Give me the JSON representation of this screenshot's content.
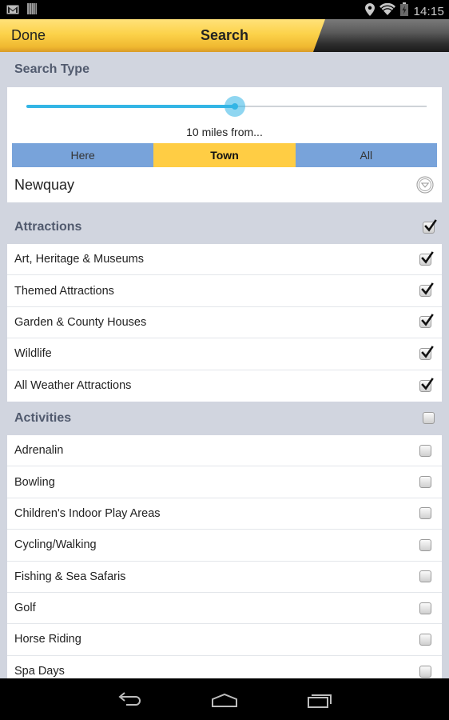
{
  "status_bar": {
    "time": "14:15",
    "left_icons": [
      "gmail-icon",
      "barcode-icon"
    ],
    "right_icons": [
      "location-icon",
      "wifi-icon",
      "battery-charging-icon"
    ]
  },
  "action_bar": {
    "done_label": "Done",
    "title": "Search"
  },
  "search_type": {
    "title": "Search Type",
    "slider_fraction": 0.52,
    "distance_label": "10 miles from...",
    "segments": [
      {
        "label": "Here",
        "active": false
      },
      {
        "label": "Town",
        "active": true
      },
      {
        "label": "All",
        "active": false
      }
    ],
    "town": "Newquay",
    "colors": {
      "accent": "#33b5e5",
      "segment": "#78a3da",
      "segment_active": "#ffcd44"
    }
  },
  "attractions": {
    "title": "Attractions",
    "all_checked": true,
    "items": [
      {
        "label": "Art, Heritage & Museums",
        "checked": true
      },
      {
        "label": "Themed Attractions",
        "checked": true
      },
      {
        "label": "Garden & County Houses",
        "checked": true
      },
      {
        "label": "Wildlife",
        "checked": true
      },
      {
        "label": "All Weather Attractions",
        "checked": true
      }
    ]
  },
  "activities": {
    "title": "Activities",
    "all_checked": false,
    "items": [
      {
        "label": "Adrenalin",
        "checked": false
      },
      {
        "label": "Bowling",
        "checked": false
      },
      {
        "label": "Children's Indoor Play Areas",
        "checked": false
      },
      {
        "label": "Cycling/Walking",
        "checked": false
      },
      {
        "label": "Fishing & Sea Safaris",
        "checked": false
      },
      {
        "label": "Golf",
        "checked": false
      },
      {
        "label": "Horse Riding",
        "checked": false
      },
      {
        "label": "Spa Days",
        "checked": false
      }
    ]
  },
  "nav_bar": {
    "buttons": [
      "back-icon",
      "home-icon",
      "recent-apps-icon"
    ]
  }
}
